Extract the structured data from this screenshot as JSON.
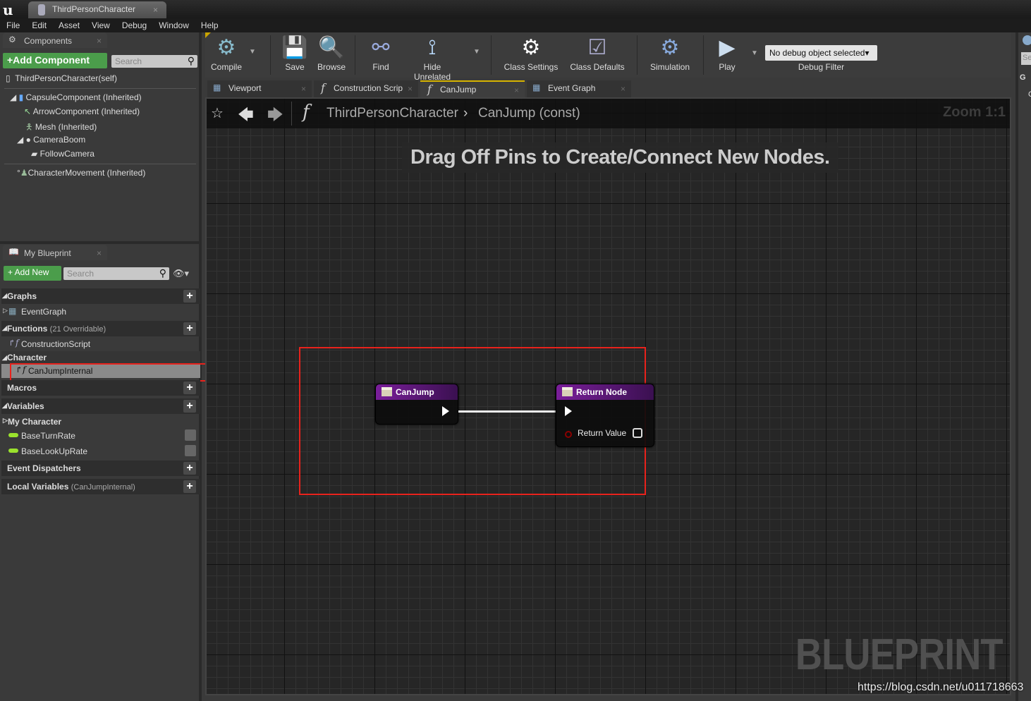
{
  "app": {
    "logo": "u",
    "document_tab": "ThirdPersonCharacter"
  },
  "menu": [
    "File",
    "Edit",
    "Asset",
    "View",
    "Debug",
    "Window",
    "Help"
  ],
  "components": {
    "tab": "Components",
    "add_button": "+Add Component",
    "search_placeholder": "Search",
    "self": "ThirdPersonCharacter(self)",
    "tree": [
      "CapsuleComponent (Inherited)",
      "ArrowComponent (Inherited)",
      "Mesh (Inherited)",
      "CameraBoom",
      "FollowCamera",
      "CharacterMovement (Inherited)"
    ]
  },
  "my_blueprint": {
    "tab": "My Blueprint",
    "add_button": "+ Add New",
    "search_placeholder": "Search",
    "sections": {
      "graphs": "Graphs",
      "event_graph": "EventGraph",
      "functions": "Functions",
      "functions_sub": "(21 Overridable)",
      "construction_script": "ConstructionScript",
      "character": "Character",
      "can_jump_internal": "CanJumpInternal",
      "macros": "Macros",
      "variables": "Variables",
      "my_character": "My Character",
      "var1": "BaseTurnRate",
      "var2": "BaseLookUpRate",
      "event_dispatchers": "Event Dispatchers",
      "local_variables": "Local Variables",
      "local_variables_sub": "(CanJumpInternal)"
    }
  },
  "toolbar": {
    "compile": "Compile",
    "save": "Save",
    "browse": "Browse",
    "find": "Find",
    "hide_unrelated": "Hide Unrelated",
    "class_settings": "Class Settings",
    "class_defaults": "Class Defaults",
    "simulation": "Simulation",
    "play": "Play",
    "debug_object": "No debug object selected",
    "debug_filter": "Debug Filter"
  },
  "graph_tabs": [
    "Viewport",
    "Construction Scrip",
    "CanJump",
    "Event Graph"
  ],
  "graph": {
    "breadcrumb_class": "ThirdPersonCharacter",
    "breadcrumb_function": "CanJump (const)",
    "zoom": "Zoom 1:1",
    "hint": "Drag Off Pins to Create/Connect New Nodes.",
    "watermark": "BLUEPRINT",
    "nodes": {
      "entry": "CanJump",
      "return": "Return Node",
      "return_value": "Return Value"
    }
  },
  "footer_url": "https://blog.csdn.net/u011718663",
  "right_panel": {
    "search_partial": "Se",
    "section_partial": "G",
    "item_partial": "C"
  },
  "colors": {
    "add_button": "#4b9d4b",
    "function_node_header": "#7a1e9a",
    "highlight_box": "#e8221c",
    "float_var": "#9be22d",
    "bool_pin": "#8b0000"
  }
}
